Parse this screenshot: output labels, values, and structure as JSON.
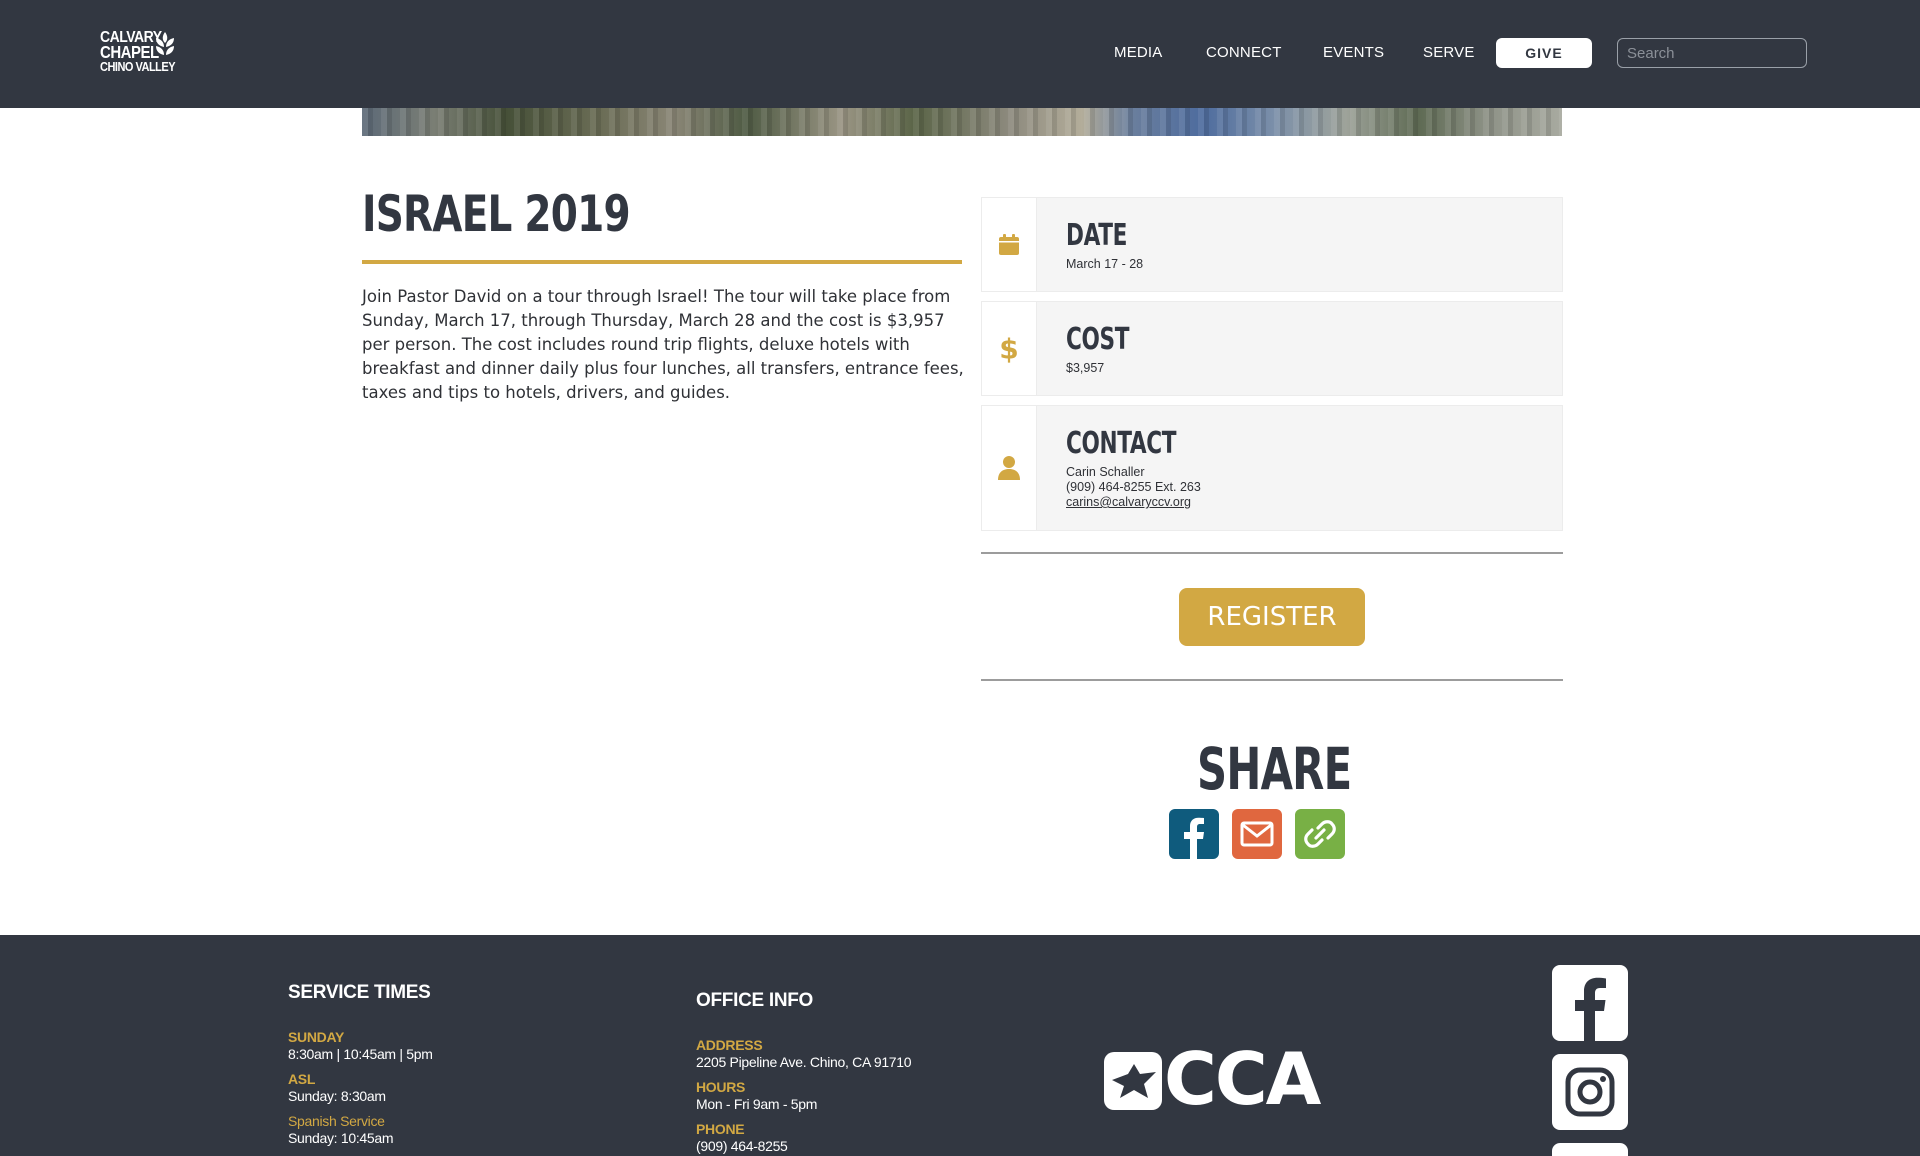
{
  "header": {
    "logo": {
      "line1": "CALVARY",
      "line2": "CHAPEL",
      "line3": "CHINO VALLEY"
    },
    "nav": [
      {
        "label": "MEDIA"
      },
      {
        "label": "CONNECT"
      },
      {
        "label": "EVENTS"
      },
      {
        "label": "SERVE"
      }
    ],
    "give_label": "GIVE",
    "search_placeholder": "Search"
  },
  "event": {
    "title": "ISRAEL 2019",
    "description": "Join Pastor David on a tour through Israel! The tour will take place from Sunday, March 17, through Thursday, March 28 and the cost is $3,957 per person. The cost includes round trip flights, deluxe hotels with breakfast and dinner daily plus four lunches, all transfers, entrance fees, taxes and tips to hotels, drivers, and guides.",
    "date": {
      "label": "DATE",
      "value": "March 17 - 28",
      "icon": "calendar-icon"
    },
    "cost": {
      "label": "COST",
      "value": "$3,957",
      "icon": "dollar-icon"
    },
    "contact": {
      "label": "CONTACT",
      "name": "Carin Schaller",
      "phone": "(909) 464-8255 Ext. 263",
      "email": "carins@calvaryccv.org",
      "icon": "person-icon"
    },
    "register_label": "REGISTER"
  },
  "share": {
    "title": "SHARE",
    "buttons": [
      {
        "icon": "facebook-icon",
        "color": "#0f5b7d"
      },
      {
        "icon": "email-icon",
        "color": "#e0673f"
      },
      {
        "icon": "link-icon",
        "color": "#78b045"
      }
    ]
  },
  "footer": {
    "service_times": {
      "heading": "SERVICE TIMES",
      "items": [
        {
          "label": "SUNDAY",
          "value": "8:30am | 10:45am | 5pm"
        },
        {
          "label": "ASL",
          "value": "Sunday: 8:30am"
        },
        {
          "label": "Spanish Service",
          "value": "Sunday: 10:45am"
        }
      ]
    },
    "office_info": {
      "heading": "OFFICE INFO",
      "items": [
        {
          "label": "ADDRESS",
          "value": "2205 Pipeline Ave. Chino, CA 91710"
        },
        {
          "label": "HOURS",
          "value": "Mon - Fri 9am - 5pm"
        },
        {
          "label": "PHONE",
          "value": "(909) 464-8255"
        }
      ]
    },
    "cca_logo_text": "CCA",
    "social": [
      {
        "icon": "facebook-icon"
      },
      {
        "icon": "instagram-icon"
      }
    ]
  },
  "colors": {
    "header_bg": "#323741",
    "accent_gold": "#d2a843",
    "card_bg": "#f5f5f5"
  }
}
